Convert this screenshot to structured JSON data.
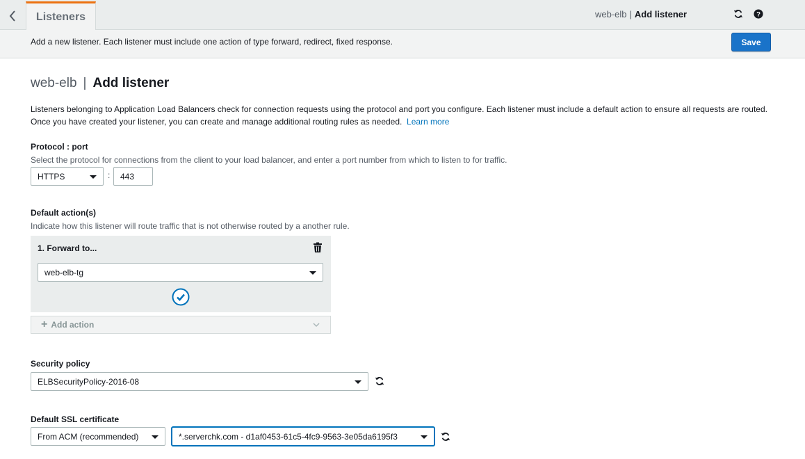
{
  "topbar": {
    "tab_label": "Listeners",
    "breadcrumb_parent": "web-elb",
    "breadcrumb_sep": "|",
    "breadcrumb_current": "Add listener",
    "icons": [
      "back-chevron-icon",
      "refresh-icon",
      "help-icon"
    ]
  },
  "infobar": {
    "text": "Add a new listener. Each listener must include one action of type forward, redirect, fixed response.",
    "save_label": "Save"
  },
  "heading": {
    "parent": "web-elb",
    "sep": "|",
    "current": "Add listener"
  },
  "description": {
    "text": "Listeners belonging to Application Load Balancers check for connection requests using the protocol and port you configure. Each listener must include a default action to ensure all requests are routed. Once you have created your listener, you can create and manage additional routing rules as needed.",
    "link": "Learn more"
  },
  "protocol_port": {
    "label": "Protocol : port",
    "hint": "Select the protocol for connections from the client to your load balancer, and enter a port number from which to listen to for traffic.",
    "protocol": "HTTPS",
    "colon": ":",
    "port": "443"
  },
  "default_actions": {
    "label": "Default action(s)",
    "hint": "Indicate how this listener will route traffic that is not otherwise routed by a another rule.",
    "action_title": "1. Forward to...",
    "target_group": "web-elb-tg",
    "add_action_label": "Add action"
  },
  "security_policy": {
    "label": "Security policy",
    "value": "ELBSecurityPolicy-2016-08"
  },
  "ssl_certificate": {
    "label": "Default SSL certificate",
    "source": "From ACM (recommended)",
    "certificate": "*.serverchk.com - d1af0453-61c5-4fc9-9563-3e05da6195f3"
  },
  "colors": {
    "accent_orange": "#ec7211",
    "primary_blue": "#1a73c9",
    "link_blue": "#0073bb",
    "panel_gray": "#eaeded"
  }
}
